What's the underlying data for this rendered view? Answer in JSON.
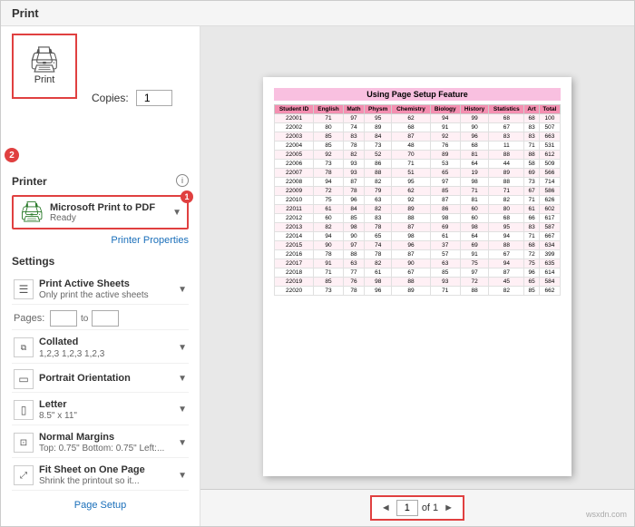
{
  "title": "Print",
  "header": {
    "copies_label": "Copies:",
    "copies_value": "1",
    "print_button_label": "Print",
    "badge_print": "2"
  },
  "printer": {
    "section_label": "Printer",
    "name": "Microsoft Print to PDF",
    "status": "Ready",
    "properties_link": "Printer Properties",
    "badge": "1",
    "info_icon": "i"
  },
  "settings": {
    "section_label": "Settings",
    "pages_label": "Pages:",
    "pages_from": "",
    "pages_to_label": "to",
    "pages_to": "",
    "page_setup_link": "Page Setup",
    "items": [
      {
        "title": "Print Active Sheets",
        "sub": "Only print the active sheets",
        "icon": "☰",
        "has_dropdown": true
      },
      {
        "title": "Collated",
        "sub": "1,2,3  1,2,3  1,2,3",
        "icon": "⧉",
        "has_dropdown": true
      },
      {
        "title": "Portrait Orientation",
        "sub": "",
        "icon": "▭",
        "has_dropdown": true
      },
      {
        "title": "Letter",
        "sub": "8.5\" x 11\"",
        "icon": "▯",
        "has_dropdown": true
      },
      {
        "title": "Normal Margins",
        "sub": "Top: 0.75\" Bottom: 0.75\" Left:...",
        "icon": "⊡",
        "has_dropdown": true
      },
      {
        "title": "Fit Sheet on One Page",
        "sub": "Shrink the printout so it...",
        "icon": "⤢",
        "has_dropdown": true
      }
    ]
  },
  "preview": {
    "title": "Using Page Setup Feature",
    "table_headers": [
      "Student ID",
      "English",
      "Math",
      "Physm",
      "Chemistry",
      "Biology",
      "History",
      "Statistics",
      "Art",
      "Total"
    ],
    "table_rows": [
      [
        "22001",
        "71",
        "97",
        "95",
        "62",
        "94",
        "99",
        "68",
        "68",
        "100"
      ],
      [
        "22002",
        "80",
        "74",
        "89",
        "68",
        "91",
        "90",
        "67",
        "83",
        "507"
      ],
      [
        "22003",
        "85",
        "83",
        "84",
        "87",
        "92",
        "96",
        "83",
        "83",
        "663"
      ],
      [
        "22004",
        "85",
        "78",
        "73",
        "48",
        "76",
        "68",
        "11",
        "71",
        "531"
      ],
      [
        "22005",
        "92",
        "82",
        "52",
        "70",
        "89",
        "81",
        "88",
        "88",
        "612"
      ],
      [
        "22006",
        "73",
        "93",
        "86",
        "71",
        "53",
        "64",
        "44",
        "58",
        "509"
      ],
      [
        "22007",
        "78",
        "93",
        "88",
        "51",
        "65",
        "19",
        "89",
        "69",
        "566"
      ],
      [
        "22008",
        "94",
        "87",
        "82",
        "95",
        "97",
        "98",
        "88",
        "73",
        "714"
      ],
      [
        "22009",
        "72",
        "78",
        "79",
        "62",
        "85",
        "71",
        "71",
        "67",
        "586"
      ],
      [
        "22010",
        "75",
        "96",
        "63",
        "92",
        "87",
        "81",
        "82",
        "71",
        "626"
      ],
      [
        "22011",
        "61",
        "84",
        "82",
        "89",
        "86",
        "60",
        "80",
        "61",
        "602"
      ],
      [
        "22012",
        "60",
        "85",
        "83",
        "88",
        "98",
        "60",
        "68",
        "66",
        "617"
      ],
      [
        "22013",
        "82",
        "98",
        "78",
        "87",
        "69",
        "98",
        "95",
        "83",
        "587"
      ],
      [
        "22014",
        "94",
        "90",
        "65",
        "98",
        "61",
        "64",
        "94",
        "71",
        "667"
      ],
      [
        "22015",
        "90",
        "97",
        "74",
        "96",
        "37",
        "69",
        "88",
        "68",
        "634"
      ],
      [
        "22016",
        "78",
        "88",
        "78",
        "87",
        "57",
        "91",
        "67",
        "72",
        "399"
      ],
      [
        "22017",
        "91",
        "63",
        "82",
        "90",
        "63",
        "75",
        "94",
        "75",
        "635"
      ],
      [
        "22018",
        "71",
        "77",
        "61",
        "67",
        "85",
        "97",
        "87",
        "96",
        "614"
      ],
      [
        "22019",
        "85",
        "76",
        "98",
        "88",
        "93",
        "72",
        "45",
        "65",
        "584"
      ],
      [
        "22020",
        "73",
        "78",
        "96",
        "89",
        "71",
        "88",
        "82",
        "85",
        "662"
      ]
    ]
  },
  "navigation": {
    "page_input": "1",
    "page_of": "of 1",
    "prev_icon": "◄",
    "next_icon": "►"
  },
  "watermark": "wsxdn.com"
}
